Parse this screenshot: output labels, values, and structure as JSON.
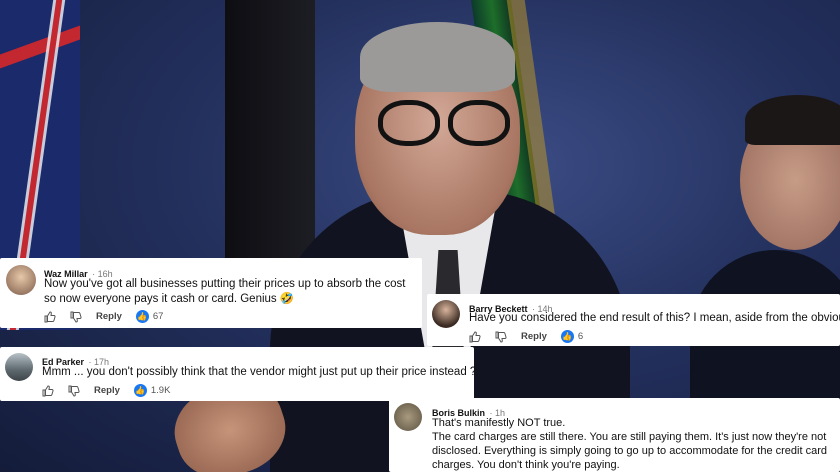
{
  "comments": [
    {
      "author": "Waz Millar",
      "time": "· 16h",
      "text": "Now you've got all businesses putting their prices up to absorb the cost so now everyone pays it cash or card. Genius 🤣",
      "reply_label": "Reply",
      "likes": "67"
    },
    {
      "author": "Barry Beckett",
      "time": "· 14h",
      "text": "Have you considered the end result of this? I mean, aside from the obvious.",
      "reply_label": "Reply",
      "likes": "6"
    },
    {
      "author": "Ed Parker",
      "time": "· 17h",
      "text": "Mmm ... you don't possibly think that the vendor might just put up their price instead ?",
      "reply_label": "Reply",
      "likes": "1.9K"
    },
    {
      "author": "Boris Bulkin",
      "time": "· 1h",
      "text_lines": [
        "That's manifestly NOT true.",
        "The card charges are still there. You are still paying them. It's just now they're not disclosed. Everything is simply going to go up to accommodate for the credit card charges. You don't think you're paying."
      ]
    }
  ],
  "colors": {
    "like_blue": "#1877f2",
    "card_bg": "#ffffff"
  }
}
